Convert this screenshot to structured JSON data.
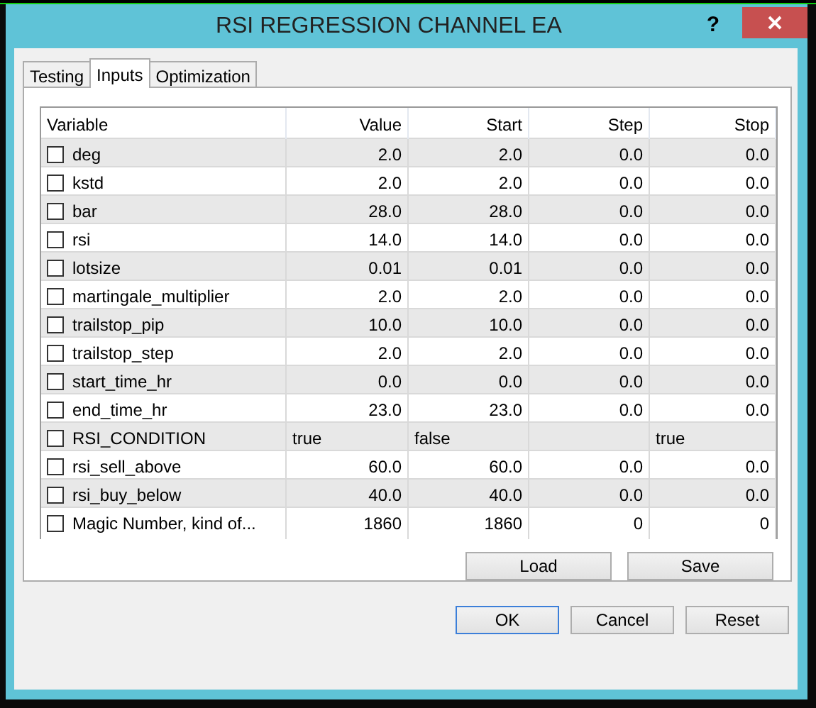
{
  "window": {
    "title": "RSI REGRESSION CHANNEL EA",
    "help": "?"
  },
  "tabs": [
    {
      "label": "Testing",
      "selected": false
    },
    {
      "label": "Inputs",
      "selected": true
    },
    {
      "label": "Optimization",
      "selected": false
    }
  ],
  "table": {
    "columns": [
      "Variable",
      "Value",
      "Start",
      "Step",
      "Stop"
    ],
    "rows": [
      {
        "kind": "number",
        "checked": false,
        "cells": [
          "deg",
          "2.0",
          "2.0",
          "0.0",
          "0.0"
        ]
      },
      {
        "kind": "number",
        "checked": false,
        "cells": [
          "kstd",
          "2.0",
          "2.0",
          "0.0",
          "0.0"
        ]
      },
      {
        "kind": "number",
        "checked": false,
        "cells": [
          "bar",
          "28.0",
          "28.0",
          "0.0",
          "0.0"
        ]
      },
      {
        "kind": "number",
        "checked": false,
        "cells": [
          "rsi",
          "14.0",
          "14.0",
          "0.0",
          "0.0"
        ]
      },
      {
        "kind": "number",
        "checked": false,
        "cells": [
          "lotsize",
          "0.01",
          "0.01",
          "0.0",
          "0.0"
        ]
      },
      {
        "kind": "number",
        "checked": false,
        "cells": [
          "martingale_multiplier",
          "2.0",
          "2.0",
          "0.0",
          "0.0"
        ]
      },
      {
        "kind": "number",
        "checked": false,
        "cells": [
          "trailstop_pip",
          "10.0",
          "10.0",
          "0.0",
          "0.0"
        ]
      },
      {
        "kind": "number",
        "checked": false,
        "cells": [
          "trailstop_step",
          "2.0",
          "2.0",
          "0.0",
          "0.0"
        ]
      },
      {
        "kind": "number",
        "checked": false,
        "cells": [
          "start_time_hr",
          "0.0",
          "0.0",
          "0.0",
          "0.0"
        ]
      },
      {
        "kind": "number",
        "checked": false,
        "cells": [
          "end_time_hr",
          "23.0",
          "23.0",
          "0.0",
          "0.0"
        ]
      },
      {
        "kind": "bool",
        "checked": false,
        "cells": [
          "RSI_CONDITION",
          "true",
          "false",
          "",
          "true"
        ]
      },
      {
        "kind": "number",
        "checked": false,
        "cells": [
          "rsi_sell_above",
          "60.0",
          "60.0",
          "0.0",
          "0.0"
        ]
      },
      {
        "kind": "number",
        "checked": false,
        "cells": [
          "rsi_buy_below",
          "40.0",
          "40.0",
          "0.0",
          "0.0"
        ]
      },
      {
        "kind": "number",
        "checked": false,
        "cells": [
          "Magic Number, kind of...",
          "1860",
          "1860",
          "0",
          "0"
        ]
      }
    ]
  },
  "panel_buttons": [
    {
      "label": "Load"
    },
    {
      "label": "Save"
    }
  ],
  "dialog_buttons": [
    {
      "label": "OK",
      "focused": true
    },
    {
      "label": "Cancel",
      "focused": false
    },
    {
      "label": "Reset",
      "focused": false
    }
  ]
}
